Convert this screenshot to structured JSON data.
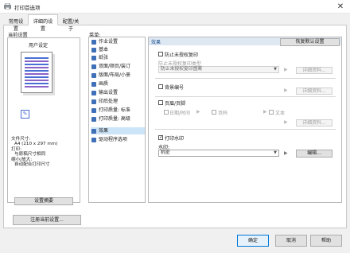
{
  "window": {
    "title": "打印首选项",
    "close_glyph": "✕"
  },
  "tabs": [
    {
      "label": "常用设置"
    },
    {
      "label": "详细的设置"
    },
    {
      "label": "配置/关于"
    }
  ],
  "summary": {
    "label": "当前设置",
    "orientation_label": "用户设定",
    "file_size_label": "文件尺寸:",
    "file_size_value": "A4 (210 x 297 mm)",
    "print_size_label": "打印:",
    "print_size_value": "与原稿尺寸相同",
    "scale_label": "缩小/放大:",
    "scale_value": "自动配合打印尺寸",
    "summary_button": "设置摘要",
    "register_button": "注册当前设置..."
  },
  "menu": {
    "label": "菜单:",
    "items": [
      {
        "label": "作业设置"
      },
      {
        "label": "基本"
      },
      {
        "label": "纸张"
      },
      {
        "label": "双面/顺页/装订"
      },
      {
        "label": "版面/布局/小册"
      },
      {
        "label": "画质"
      },
      {
        "label": "输出设置"
      },
      {
        "label": "印后处理"
      },
      {
        "label": "打印质量: 标准"
      },
      {
        "label": "打印质量: 高级"
      },
      {
        "label": "效果"
      },
      {
        "label": "驱动程序选项"
      }
    ],
    "selected_index": 10
  },
  "effects": {
    "header": "效果",
    "restore_button": "恢复默认设置",
    "anti_copy": {
      "checkbox_label": "防止未授权复印",
      "type_label": "防止未授权复印类型",
      "type_value": "防止未授权复印图案",
      "details_button": "详细资料..."
    },
    "background": {
      "checkbox_label": "背景编号",
      "details_button": "详细资料..."
    },
    "header_footer": {
      "checkbox_label": "页眉/页脚",
      "date_label": "日期/时间",
      "page_label": "页码",
      "text_label": "文本",
      "details_button": "详细资料..."
    },
    "watermark": {
      "checkbox_label": "打印水印",
      "field_label": "水印:",
      "value": "机密",
      "edit_button": "编辑..."
    }
  },
  "footer": {
    "ok": "确定",
    "cancel": "取消",
    "help": "帮助"
  }
}
